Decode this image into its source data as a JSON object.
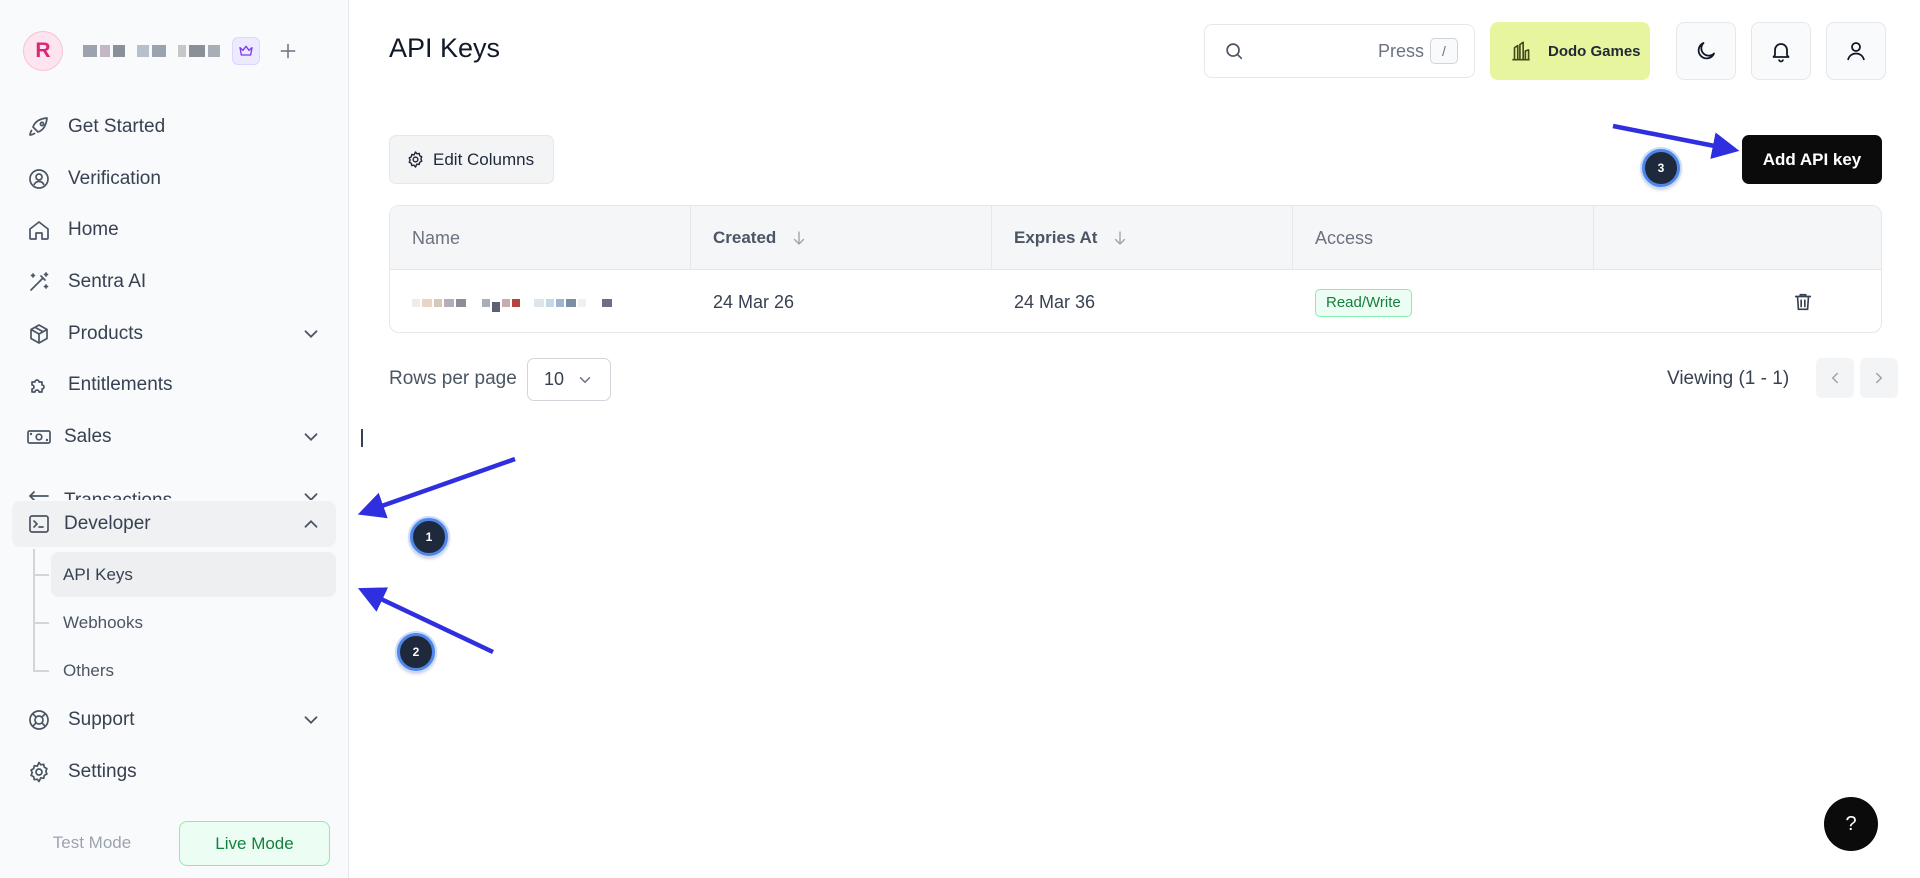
{
  "workspace": {
    "avatar_letter": "R"
  },
  "sidebar": {
    "items": [
      {
        "label": "Get Started",
        "icon": "rocket-icon"
      },
      {
        "label": "Verification",
        "icon": "verification-icon"
      },
      {
        "label": "Home",
        "icon": "home-icon"
      },
      {
        "label": "Sentra AI",
        "icon": "magic-wand-icon"
      },
      {
        "label": "Products",
        "icon": "box-icon"
      },
      {
        "label": "Entitlements",
        "icon": "puzzle-icon"
      },
      {
        "label": "Sales",
        "icon": "money-icon"
      },
      {
        "label": "Transactions",
        "icon": "transactions-icon"
      },
      {
        "label": "Developer",
        "icon": "terminal-icon"
      },
      {
        "label": "Support",
        "icon": "lifebuoy-icon"
      },
      {
        "label": "Settings",
        "icon": "gear-icon"
      }
    ],
    "developer_sub": [
      {
        "label": "API Keys"
      },
      {
        "label": "Webhooks"
      },
      {
        "label": "Others"
      }
    ],
    "modes": {
      "test": "Test Mode",
      "live": "Live Mode"
    }
  },
  "header": {
    "title": "API Keys",
    "search_hint": "Press",
    "search_shortcut": "/",
    "brand_name": "Dodo Games"
  },
  "toolbar": {
    "edit_columns": "Edit Columns",
    "add_key": "Add API key"
  },
  "table": {
    "columns": [
      "Name",
      "Created",
      "Expries At",
      "Access"
    ],
    "rows": [
      {
        "created": "24 Mar 26",
        "expires": "24 Mar 36",
        "access": "Read/Write"
      }
    ]
  },
  "pagination": {
    "rows_label": "Rows per page",
    "rows_value": "10",
    "viewing": "Viewing (1 - 1)"
  },
  "annotations": [
    "1",
    "2",
    "3"
  ],
  "help": "?",
  "colors": {
    "brand_bg": "#e7f69e",
    "primary_button": "#0b0b0b",
    "access_badge": "#15803d",
    "annotation_arrow": "#2f2fe0",
    "avatar_text": "#db2777"
  }
}
